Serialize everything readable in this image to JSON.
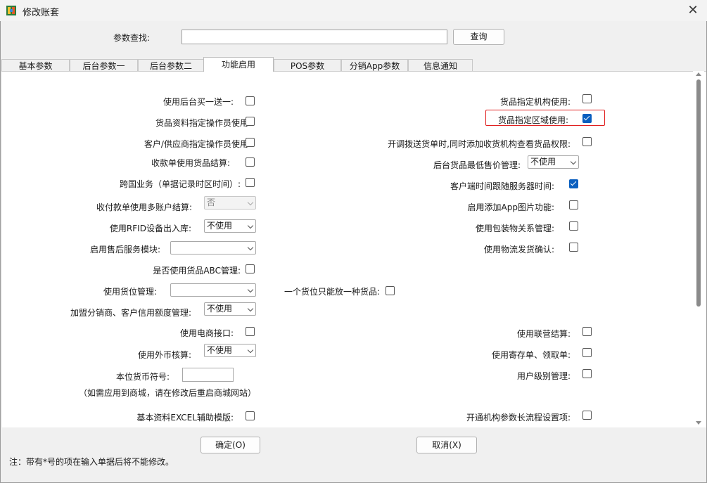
{
  "window": {
    "title": "修改账套",
    "close_glyph": "✕"
  },
  "search": {
    "label": "参数查找:",
    "value": "",
    "button": "查询"
  },
  "tabs": [
    {
      "label": "基本参数",
      "active": false
    },
    {
      "label": "后台参数一",
      "active": false
    },
    {
      "label": "后台参数二",
      "active": false
    },
    {
      "label": "功能启用",
      "active": true
    },
    {
      "label": "POS参数",
      "active": false
    },
    {
      "label": "分销App参数",
      "active": false
    },
    {
      "label": "信息通知",
      "active": false
    }
  ],
  "left_options": {
    "buy_one_get_one": {
      "label": "使用后台买一送一:",
      "checked": false
    },
    "goods_operator": {
      "label": "货品资料指定操作员使用:",
      "checked": false
    },
    "customer_supplier_operator": {
      "label": "客户/供应商指定操作员使用:",
      "checked": false
    },
    "receipt_goods_settle": {
      "label": "收款单使用货品结算:",
      "checked": false
    },
    "cross_border": {
      "label": "跨国业务（单据记录时区时间）:",
      "checked": false
    },
    "multi_account_settle": {
      "label": "收付款单使用多账户结算:",
      "select_value": "否"
    },
    "rfid_io": {
      "label": "使用RFID设备出入库:",
      "select_value": "不使用"
    },
    "after_sales": {
      "label": "启用售后服务模块:",
      "select_value": ""
    },
    "abc_management": {
      "label": "是否使用货品ABC管理:",
      "checked": false
    },
    "location_management": {
      "label": "使用货位管理:",
      "select_value": ""
    },
    "franchise_credit": {
      "label": "加盟分销商、客户信用额度管理:",
      "select_value": "不使用"
    },
    "ecommerce_api": {
      "label": "使用电商接口:",
      "checked": false
    },
    "foreign_currency": {
      "label": "使用外币核算:",
      "select_value": "不使用"
    },
    "local_currency_symbol": {
      "label": "本位货币符号:",
      "value": ""
    },
    "local_currency_note": "（如需应用到商城，请在修改后重启商城网站）",
    "excel_template": {
      "label": "基本资料EXCEL辅助模版:",
      "checked": false
    }
  },
  "middle_options": {
    "one_goods_per_location": {
      "label": "一个货位只能放一种货品:",
      "checked": false
    }
  },
  "right_options": {
    "goods_org": {
      "label": "货品指定机构使用:",
      "checked": false
    },
    "goods_region": {
      "label": "货品指定区域使用:",
      "checked": true
    },
    "transfer_permission": {
      "label": "开调拨送货单时,同时添加收货机构查看货品权限:",
      "checked": false
    },
    "min_price": {
      "label": "后台货品最低售价管理:",
      "select_value": "不使用"
    },
    "client_server_time": {
      "label": "客户端时间跟随服务器时间:",
      "checked": true
    },
    "app_images": {
      "label": "启用添加App图片功能:",
      "checked": false
    },
    "packaging_relation": {
      "label": "使用包装物关系管理:",
      "checked": false
    },
    "logistics_confirm": {
      "label": "使用物流发货确认:",
      "checked": false
    },
    "joint_settlement": {
      "label": "使用联营结算:",
      "checked": false
    },
    "consignment": {
      "label": "使用寄存单、领取单:",
      "checked": false
    },
    "user_level": {
      "label": "用户级别管理:",
      "checked": false
    },
    "org_long_process": {
      "label": "开通机构参数长流程设置项:",
      "checked": false
    }
  },
  "footer": {
    "ok": "确定(O)",
    "cancel": "取消(X)",
    "note": "注：带有*号的项在输入单据后将不能修改。"
  },
  "icons": {
    "app": "app-icon",
    "close": "close-icon",
    "chevron": "chevron-down-icon",
    "check": "check-icon"
  }
}
